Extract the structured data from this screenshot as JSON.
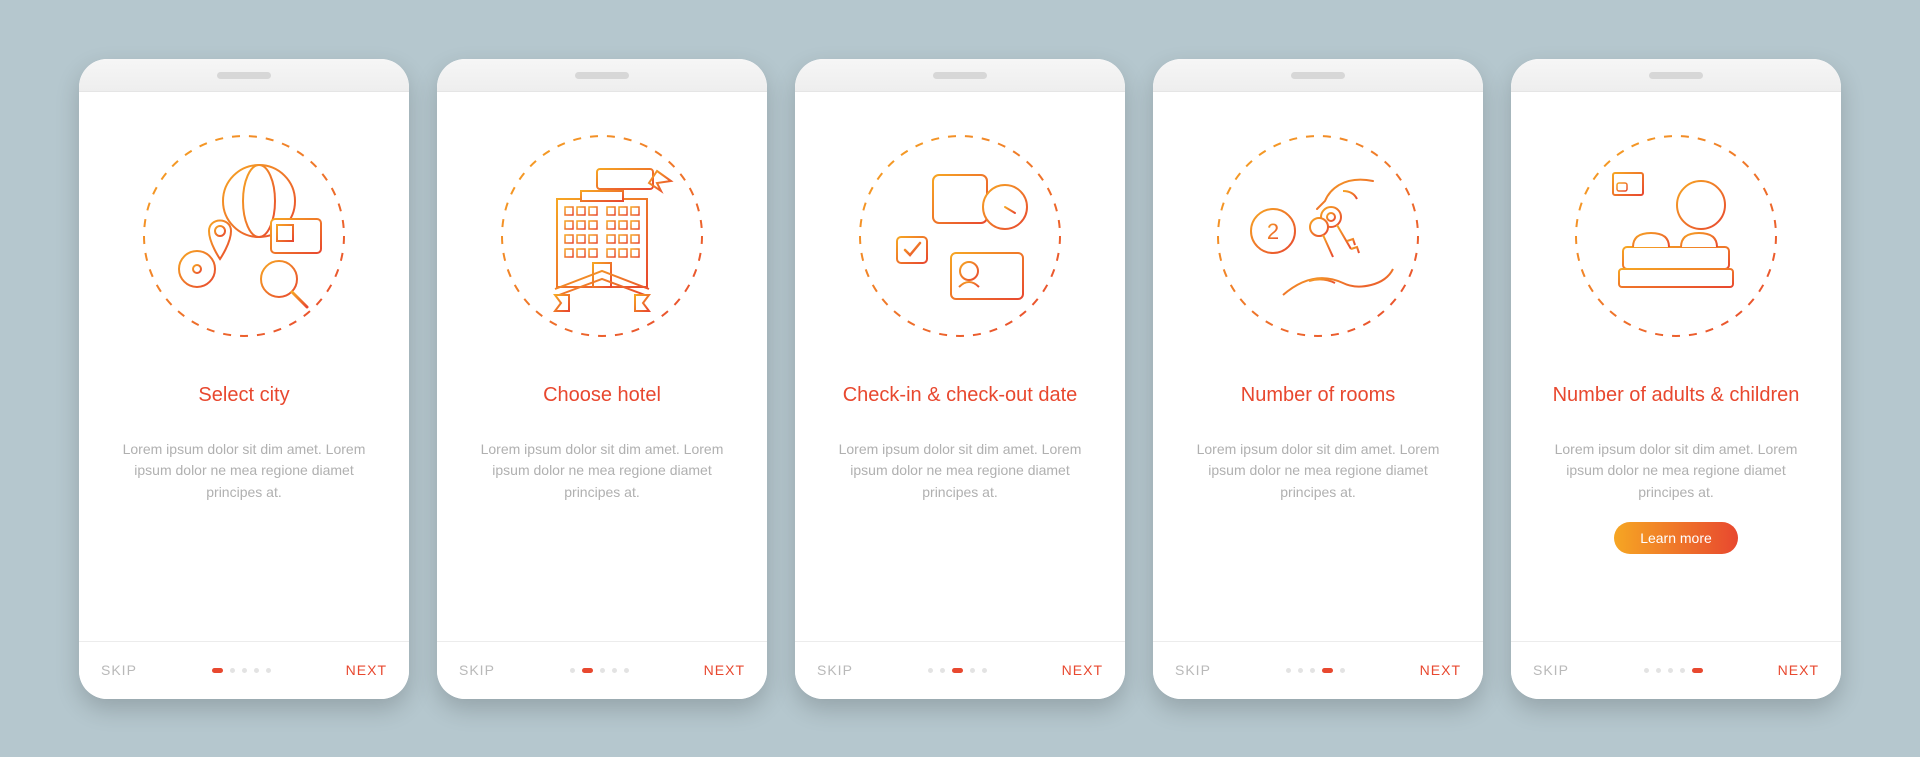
{
  "colors": {
    "accent_start": "#f6a623",
    "accent_end": "#e8482f",
    "muted": "#b0b0b0"
  },
  "common": {
    "skip": "SKIP",
    "next": "NEXT",
    "description": "Lorem ipsum dolor sit dim amet. Lorem ipsum dolor ne mea regione diamet principes at.",
    "learn_more": "Learn more"
  },
  "screens": [
    {
      "title": "Select city",
      "icon": "globe-map-pin",
      "active_dot": 0,
      "has_learn": false
    },
    {
      "title": "Choose hotel",
      "icon": "hotel-building",
      "active_dot": 1,
      "has_learn": false
    },
    {
      "title": "Check-in & check-out date",
      "icon": "calendar-clock",
      "active_dot": 2,
      "has_learn": false
    },
    {
      "title": "Number of rooms",
      "icon": "keys-hand",
      "active_dot": 3,
      "has_learn": false
    },
    {
      "title": "Number of adults & children",
      "icon": "bed-plus",
      "active_dot": 4,
      "has_learn": true
    }
  ],
  "dot_count": 5
}
